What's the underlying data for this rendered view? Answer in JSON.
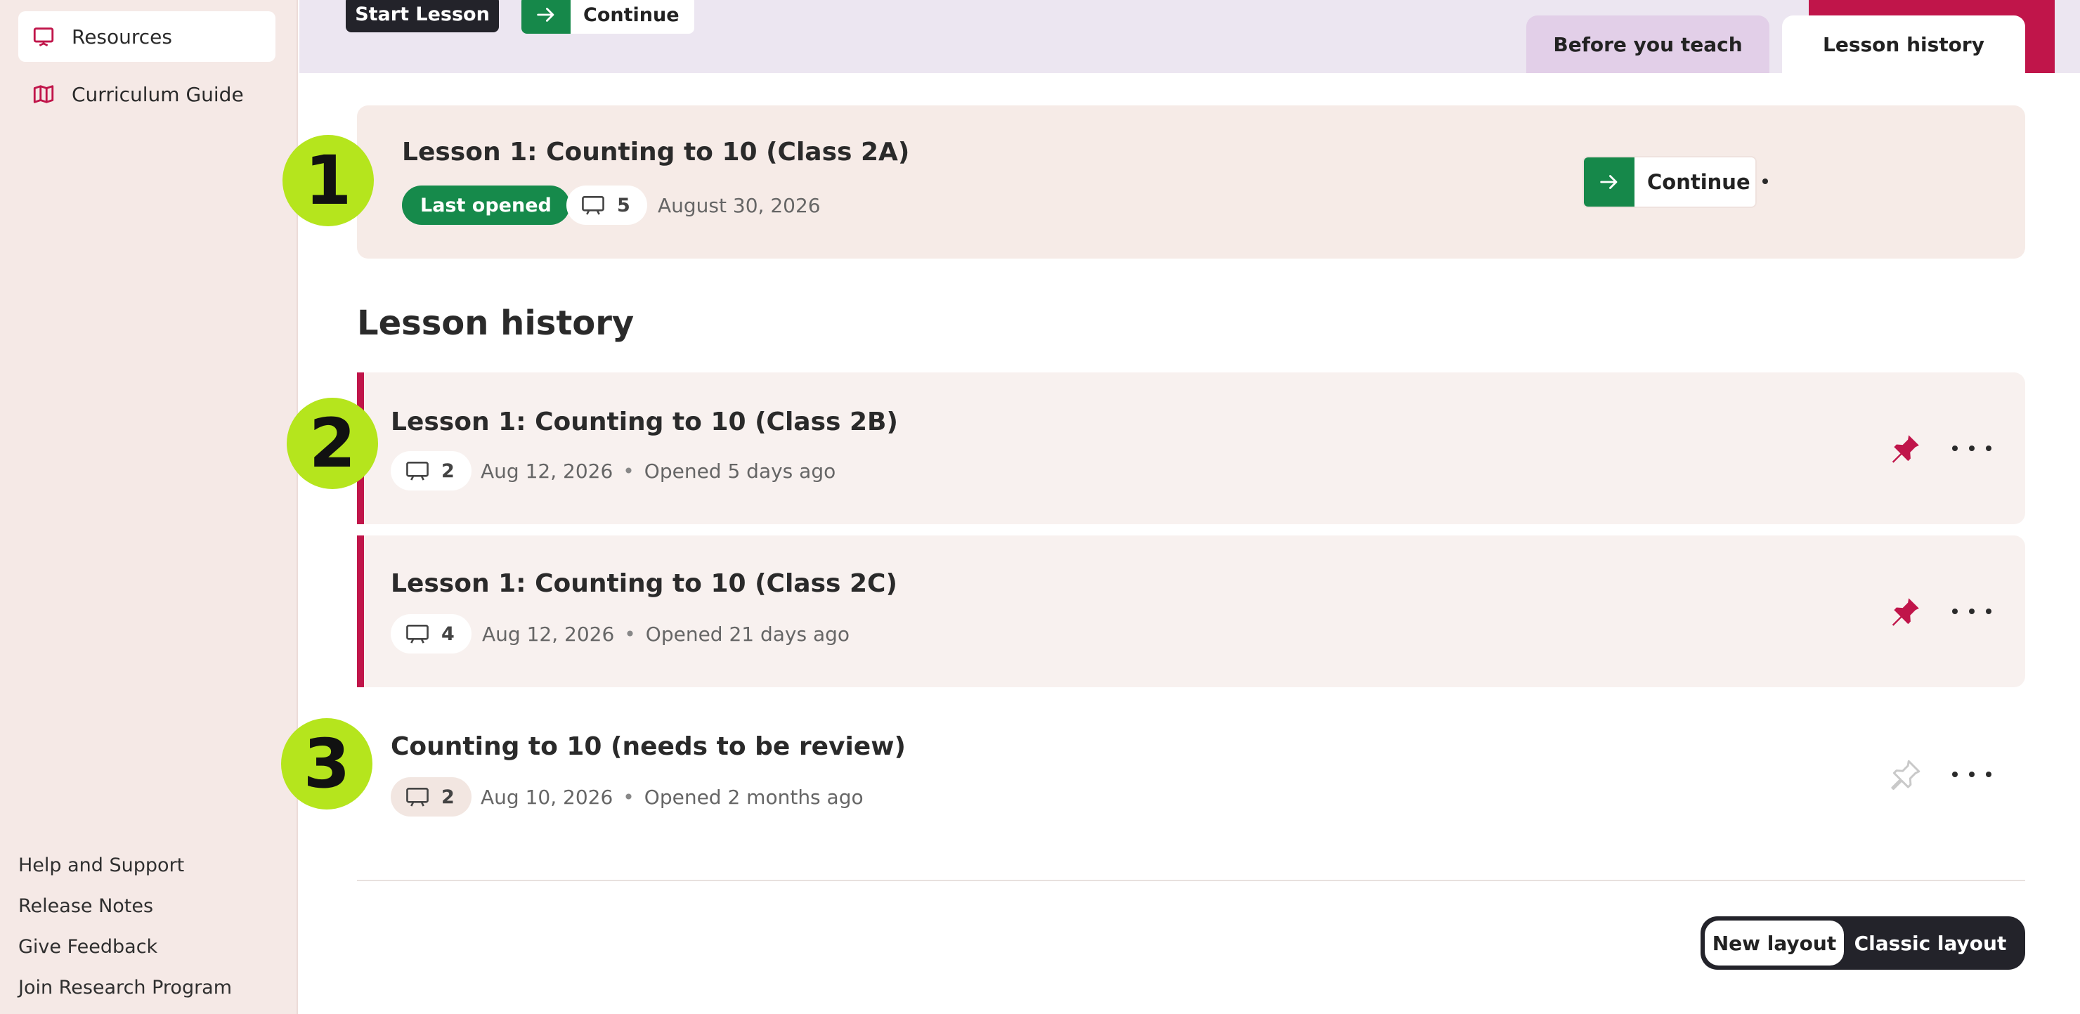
{
  "sidebar": {
    "items": [
      {
        "label": "Resources",
        "icon": "presentation-icon",
        "active": true
      },
      {
        "label": "Curriculum Guide",
        "icon": "map-icon",
        "active": false
      }
    ],
    "footer": [
      "Help and Support",
      "Release Notes",
      "Give Feedback",
      "Join Research Program"
    ]
  },
  "header": {
    "start_lesson": "Start Lesson",
    "continue": "Continue",
    "tabs": [
      {
        "label": "Before you teach",
        "active": false
      },
      {
        "label": "Lesson history",
        "active": true
      }
    ]
  },
  "current": {
    "title": "Lesson 1: Counting to 10 (Class 2A)",
    "badge": "Last opened",
    "comments": "5",
    "date": "August 30, 2026",
    "pinned": true,
    "continue": "Continue"
  },
  "section_title": "Lesson history",
  "history": [
    {
      "title": "Lesson 1: Counting to 10 (Class 2B)",
      "comments": "2",
      "date": "Aug 12, 2026",
      "opened": "Opened 5 days ago",
      "pinned": true
    },
    {
      "title": "Lesson 1: Counting to 10 (Class 2C)",
      "comments": "4",
      "date": "Aug 12, 2026",
      "opened": "Opened 21 days ago",
      "pinned": true
    },
    {
      "title": "Counting to 10 (needs to be review)",
      "comments": "2",
      "date": "Aug 10, 2026",
      "opened": "Opened 2 months ago",
      "pinned": false
    }
  ],
  "separator": "•",
  "markers": [
    "1",
    "2",
    "3"
  ],
  "layout_toggle": {
    "new": "New layout",
    "classic": "Classic layout",
    "selected": "New layout"
  },
  "colors": {
    "accent": "#c0154a",
    "green": "#168a4b",
    "marker": "#b5e51d",
    "sidebar_bg": "#f5e9e6",
    "topband": "#ece6f1"
  }
}
